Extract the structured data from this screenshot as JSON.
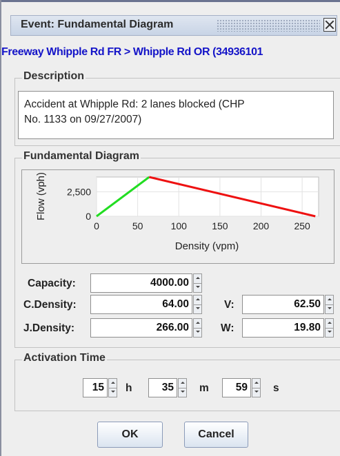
{
  "window": {
    "title": "Event: Fundamental Diagram"
  },
  "route": "Freeway Whipple Rd FR > Whipple Rd OR (34936101",
  "description": {
    "label": "Description",
    "text_line1": "Accident at Whipple Rd: 2 lanes blocked (CHP",
    "text_line2": "No. 1133 on 09/27/2007)"
  },
  "fundamental_diagram": {
    "label": "Fundamental Diagram"
  },
  "chart_data": {
    "type": "line",
    "xlabel": "Density (vpm)",
    "ylabel": "Flow (vph)",
    "xlim": [
      0,
      270
    ],
    "ylim": [
      0,
      4000
    ],
    "x_ticks": [
      "0",
      "50",
      "100",
      "150",
      "200",
      "250"
    ],
    "y_ticks": [
      "0",
      "2,500"
    ],
    "grid": true,
    "series": [
      {
        "color": "#22dd22",
        "x": [
          0,
          64
        ],
        "y": [
          0,
          4000
        ]
      },
      {
        "color": "#ee1111",
        "x": [
          64,
          266
        ],
        "y": [
          4000,
          0
        ]
      }
    ]
  },
  "params": {
    "capacity_label": "Capacity:",
    "capacity_value": "4000.00",
    "cdensity_label": "C.Density:",
    "cdensity_value": "64.00",
    "v_label": "V:",
    "v_value": "62.50",
    "jdensity_label": "J.Density:",
    "jdensity_value": "266.00",
    "w_label": "W:",
    "w_value": "19.80"
  },
  "activation": {
    "label": "Activation Time",
    "hours": "15",
    "h_unit": "h",
    "minutes": "35",
    "m_unit": "m",
    "seconds": "59",
    "s_unit": "s"
  },
  "buttons": {
    "ok": "OK",
    "cancel": "Cancel"
  }
}
